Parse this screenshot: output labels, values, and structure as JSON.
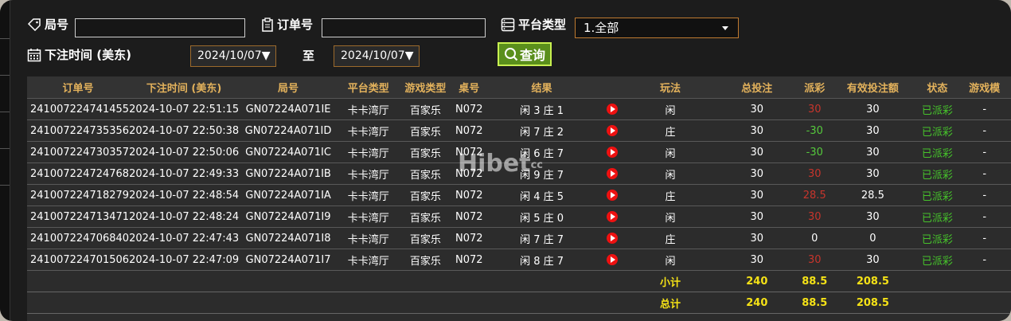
{
  "filters": {
    "round_label": "局号",
    "round_value": "",
    "order_label": "订单号",
    "order_value": "",
    "platform_label": "平台类型",
    "platform_selected": "1.全部",
    "time_label": "下注时间 (美东)",
    "date_from": "2024/10/07▼",
    "to_label": "至",
    "date_to": "2024/10/07▼",
    "query_label": "查询"
  },
  "table": {
    "headers": [
      "订单号",
      "下注时间 (美东)",
      "局号",
      "平台类型",
      "游戏类型",
      "桌号",
      "结果",
      "",
      "玩法",
      "总投注",
      "派彩",
      "有效投注额",
      "状态",
      "游戏模"
    ],
    "rows": [
      {
        "order": "241007224741455",
        "time": "2024-10-07 22:51:15",
        "round": "GN07224A071IE",
        "platform": "卡卡湾厅",
        "game": "百家乐",
        "table": "N072",
        "result": "闲 3 庄 1",
        "play": "闲",
        "bet": "30",
        "payout": "30",
        "payout_color": "red",
        "valid": "30",
        "status": "已派彩",
        "mode": "-"
      },
      {
        "order": "241007224735356",
        "time": "2024-10-07 22:50:38",
        "round": "GN07224A071ID",
        "platform": "卡卡湾厅",
        "game": "百家乐",
        "table": "N072",
        "result": "闲 7 庄 2",
        "play": "庄",
        "bet": "30",
        "payout": "-30",
        "payout_color": "green",
        "valid": "30",
        "status": "已派彩",
        "mode": "-"
      },
      {
        "order": "241007224730357",
        "time": "2024-10-07 22:50:06",
        "round": "GN07224A071IC",
        "platform": "卡卡湾厅",
        "game": "百家乐",
        "table": "N072",
        "result": "闲 6 庄 7",
        "play": "闲",
        "bet": "30",
        "payout": "-30",
        "payout_color": "green",
        "valid": "30",
        "status": "已派彩",
        "mode": "-"
      },
      {
        "order": "241007224724768",
        "time": "2024-10-07 22:49:33",
        "round": "GN07224A071IB",
        "platform": "卡卡湾厅",
        "game": "百家乐",
        "table": "N072",
        "result": "闲 9 庄 7",
        "play": "闲",
        "bet": "30",
        "payout": "30",
        "payout_color": "red",
        "valid": "30",
        "status": "已派彩",
        "mode": "-"
      },
      {
        "order": "241007224718279",
        "time": "2024-10-07 22:48:54",
        "round": "GN07224A071IA",
        "platform": "卡卡湾厅",
        "game": "百家乐",
        "table": "N072",
        "result": "闲 4 庄 5",
        "play": "庄",
        "bet": "30",
        "payout": "28.5",
        "payout_color": "red",
        "valid": "28.5",
        "status": "已派彩",
        "mode": "-"
      },
      {
        "order": "241007224713471",
        "time": "2024-10-07 22:48:24",
        "round": "GN07224A071I9",
        "platform": "卡卡湾厅",
        "game": "百家乐",
        "table": "N072",
        "result": "闲 5 庄 0",
        "play": "闲",
        "bet": "30",
        "payout": "30",
        "payout_color": "red",
        "valid": "30",
        "status": "已派彩",
        "mode": "-"
      },
      {
        "order": "241007224706840",
        "time": "2024-10-07 22:47:43",
        "round": "GN07224A071I8",
        "platform": "卡卡湾厅",
        "game": "百家乐",
        "table": "N072",
        "result": "闲 7 庄 7",
        "play": "庄",
        "bet": "30",
        "payout": "0",
        "payout_color": "white",
        "valid": "0",
        "status": "已派彩",
        "mode": "-"
      },
      {
        "order": "241007224701506",
        "time": "2024-10-07 22:47:09",
        "round": "GN07224A071I7",
        "platform": "卡卡湾厅",
        "game": "百家乐",
        "table": "N072",
        "result": "闲 8 庄 7",
        "play": "闲",
        "bet": "30",
        "payout": "30",
        "payout_color": "red",
        "valid": "30",
        "status": "已派彩",
        "mode": "-"
      }
    ],
    "subtotal": {
      "label": "小计",
      "bet": "240",
      "payout": "88.5",
      "valid": "208.5"
    },
    "total": {
      "label": "总计",
      "bet": "240",
      "payout": "88.5",
      "valid": "208.5"
    }
  },
  "watermark": {
    "main": "Hibet",
    "sub": "cc"
  },
  "colors": {
    "header_text": "#e3b25c",
    "status": "#46c22b",
    "sum_text": "#f5e216",
    "win": "#c7352c",
    "loss": "#55c93c"
  }
}
